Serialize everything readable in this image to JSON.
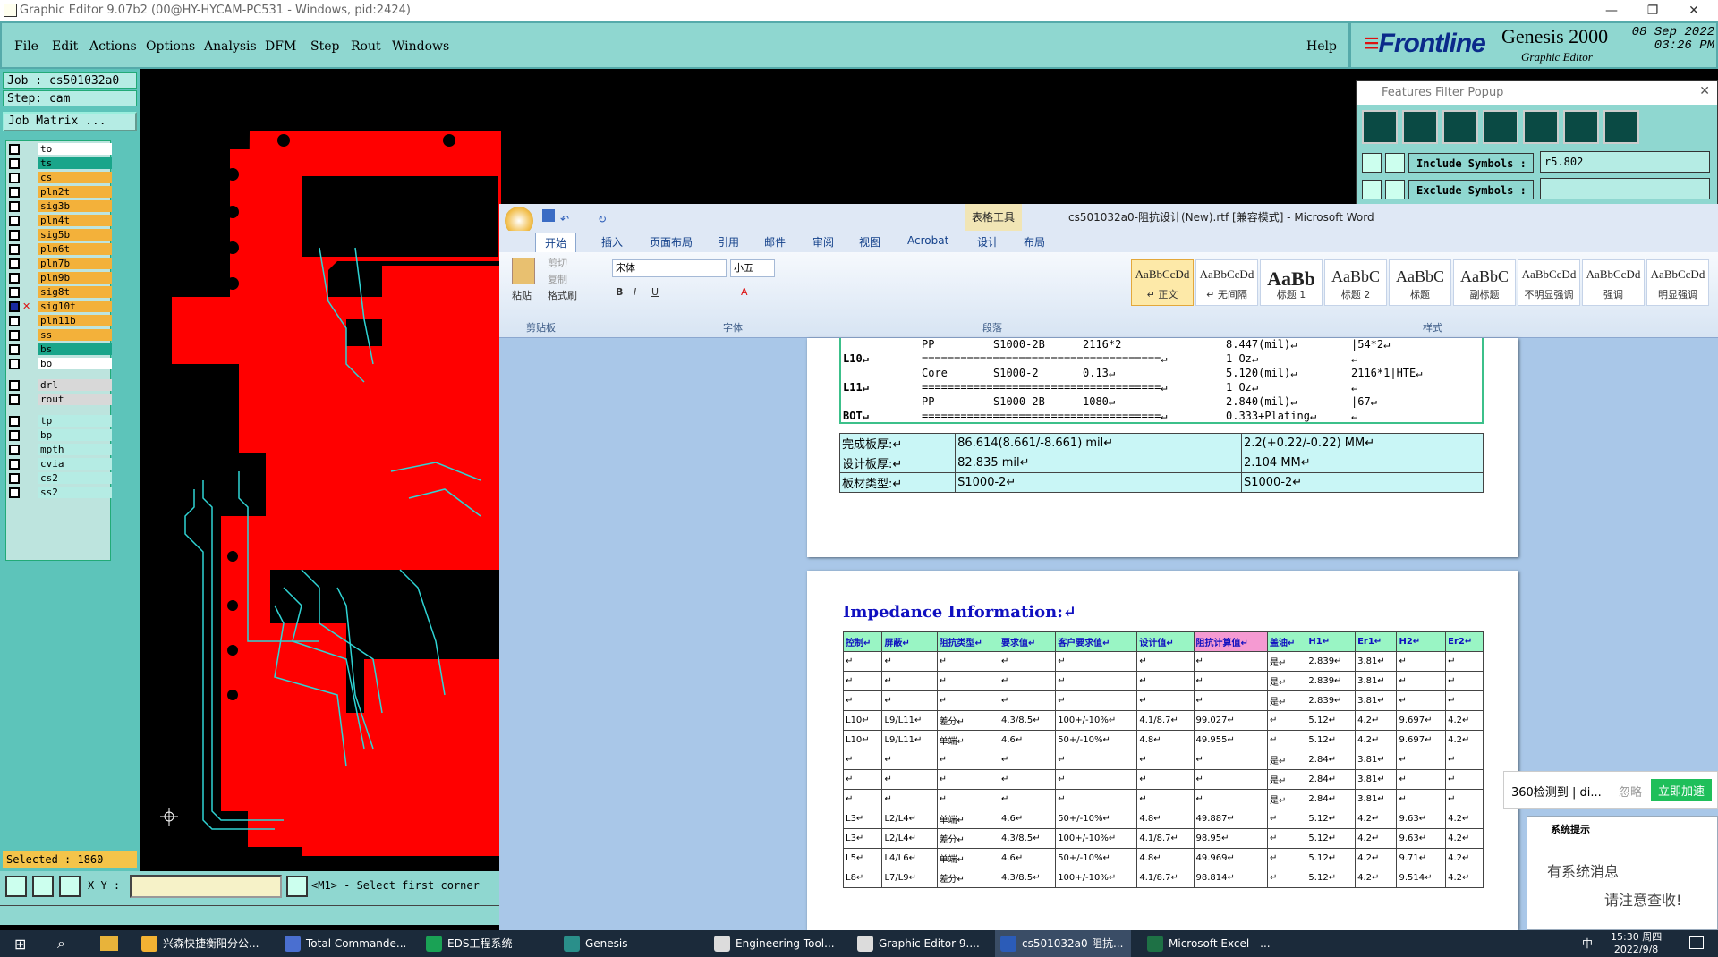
{
  "genesis": {
    "title": "Graphic Editor 9.07b2 (00@HY-HYCAM-PC531 - Windows, pid:2424)",
    "menus": [
      "File",
      "Edit",
      "Actions",
      "Options",
      "Analysis",
      "DFM",
      "Step",
      "Rout",
      "Windows"
    ],
    "help": "Help",
    "brand": {
      "logo": "Frontline",
      "product": "Genesis 2000",
      "subtitle": "Graphic Editor",
      "date": "08 Sep 2022",
      "time": "03:26 PM"
    },
    "job_label": "Job : cs501032a0",
    "step_label": "Step: cam",
    "job_matrix": "Job Matrix ...",
    "layers": [
      {
        "name": "to",
        "color": "#ffffff",
        "mark": "pen"
      },
      {
        "name": "ts",
        "color": "#19a58a"
      },
      {
        "name": "cs",
        "color": "#f3b13a"
      },
      {
        "name": "pln2t",
        "color": "#f3b13a"
      },
      {
        "name": "sig3b",
        "color": "#f3b13a"
      },
      {
        "name": "pln4t",
        "color": "#f3b13a"
      },
      {
        "name": "sig5b",
        "color": "#f3b13a"
      },
      {
        "name": "pln6t",
        "color": "#f3b13a"
      },
      {
        "name": "pln7b",
        "color": "#f3b13a"
      },
      {
        "name": "pln9b",
        "color": "#f3b13a"
      },
      {
        "name": "sig8t",
        "color": "#f3b13a"
      },
      {
        "name": "sig10t",
        "color": "#f3b13a",
        "active": true,
        "mark": "eq"
      },
      {
        "name": "pln11b",
        "color": "#f3b13a"
      },
      {
        "name": "ss",
        "color": "#f3b13a"
      },
      {
        "name": "bs",
        "color": "#19a58a"
      },
      {
        "name": "bo",
        "color": "#ffffff",
        "mark": "pen"
      },
      {
        "name": "drl",
        "color": "#d8d8d8"
      },
      {
        "name": "rout",
        "color": "#d8d8d8"
      },
      {
        "name": "tp",
        "color": "#b5ece4"
      },
      {
        "name": "bp",
        "color": "#b5ece4"
      },
      {
        "name": "mpth",
        "color": "#b5ece4"
      },
      {
        "name": "cvia",
        "color": "#b5ece4"
      },
      {
        "name": "cs2",
        "color": "#b5ece4"
      },
      {
        "name": "ss2",
        "color": "#b5ece4"
      }
    ],
    "selected": "Selected : 1860",
    "xy_label": "X Y :",
    "status": "<M1> - Select first corner"
  },
  "features_filter": {
    "title": "Features Filter Popup",
    "include_label": "Include Symbols :",
    "include_value": "r5.802",
    "exclude_label": "Exclude Symbols :",
    "exclude_value": ""
  },
  "word": {
    "tool_context": "表格工具",
    "title": "cs501032a0-阻抗设计(New).rtf [兼容模式] - Microsoft Word",
    "tabs": [
      "开始",
      "插入",
      "页面布局",
      "引用",
      "邮件",
      "审阅",
      "视图",
      "Acrobat",
      "设计",
      "布局"
    ],
    "clipboard": {
      "paste": "粘贴",
      "cut": "剪切",
      "copy": "复制",
      "format_painter": "格式刷",
      "group": "剪贴板"
    },
    "font": {
      "name": "宋体",
      "size": "小五",
      "group": "字体"
    },
    "paragraph_group": "段落",
    "styles_group": "样式",
    "styles": [
      {
        "preview": "AaBbCcDd",
        "name": "↵ 正文"
      },
      {
        "preview": "AaBbCcDd",
        "name": "↵ 无间隔"
      },
      {
        "preview": "AaBb",
        "name": "标题 1"
      },
      {
        "preview": "AaBbC",
        "name": "标题 2"
      },
      {
        "preview": "AaBbC",
        "name": "标题"
      },
      {
        "preview": "AaBbC",
        "name": "副标题"
      },
      {
        "preview": "AaBbCcDd",
        "name": "不明显强调"
      },
      {
        "preview": "AaBbCcDd",
        "name": "强调"
      },
      {
        "preview": "AaBbCcDd",
        "name": "明显强调"
      }
    ],
    "stackup": [
      {
        "layer": "",
        "c1": "PP",
        "c2": "S1000-2B",
        "c3": "2116*2",
        "val": "8.447(mil)↵",
        "note": "|54*2↵"
      },
      {
        "layer": "L10↵",
        "c1": "=====================================↵",
        "c2": "",
        "c3": "",
        "val": "1 Oz↵",
        "note": "↵"
      },
      {
        "layer": "",
        "c1": "Core",
        "c2": "S1000-2",
        "c3": "0.13↵",
        "val": "5.120(mil)↵",
        "note": "2116*1|HTE↵"
      },
      {
        "layer": "L11↵",
        "c1": "=====================================↵",
        "c2": "",
        "c3": "",
        "val": "1 Oz↵",
        "note": "↵"
      },
      {
        "layer": "",
        "c1": "PP",
        "c2": "S1000-2B",
        "c3": "1080↵",
        "val": "2.840(mil)↵",
        "note": "|67↵"
      },
      {
        "layer": "BOT↵",
        "c1": "=====================================↵",
        "c2": "",
        "c3": "",
        "val": "0.333+Plating↵",
        "note": "↵"
      }
    ],
    "summary": [
      {
        "label": "完成板厚:↵",
        "mil": "86.614(8.661/-8.661) mil↵",
        "mm": "2.2(+0.22/-0.22) MM↵"
      },
      {
        "label": "设计板厚:↵",
        "mil": "82.835 mil↵",
        "mm": "2.104 MM↵"
      },
      {
        "label": "板材类型:↵",
        "mil": "S1000-2↵",
        "mm": "S1000-2↵"
      }
    ],
    "impedance_title": "Impedance Information:↵",
    "imp_headers": [
      "控制↵",
      "屏蔽↵",
      "阻抗类型↵",
      "要求值↵",
      "客户要求值↵",
      "设计值↵",
      "阻抗计算值↵",
      "盖油↵",
      "H1↵",
      "Er1↵",
      "H2↵",
      "Er2↵"
    ],
    "imp_rows": [
      [
        "↵",
        "↵",
        "↵",
        "↵",
        "↵",
        "↵",
        "↵",
        "是↵",
        "2.839↵",
        "3.81↵",
        "↵",
        "↵"
      ],
      [
        "↵",
        "↵",
        "↵",
        "↵",
        "↵",
        "↵",
        "↵",
        "是↵",
        "2.839↵",
        "3.81↵",
        "↵",
        "↵"
      ],
      [
        "↵",
        "↵",
        "↵",
        "↵",
        "↵",
        "↵",
        "↵",
        "是↵",
        "2.839↵",
        "3.81↵",
        "↵",
        "↵"
      ],
      [
        "L10↵",
        "L9/L11↵",
        "差分↵",
        "4.3/8.5↵",
        "100+/-10%↵",
        "4.1/8.7↵",
        "99.027↵",
        "↵",
        "5.12↵",
        "4.2↵",
        "9.697↵",
        "4.2↵"
      ],
      [
        "L10↵",
        "L9/L11↵",
        "单端↵",
        "4.6↵",
        "50+/-10%↵",
        "4.8↵",
        "49.955↵",
        "↵",
        "5.12↵",
        "4.2↵",
        "9.697↵",
        "4.2↵"
      ],
      [
        "↵",
        "↵",
        "↵",
        "↵",
        "↵",
        "↵",
        "↵",
        "是↵",
        "2.84↵",
        "3.81↵",
        "↵",
        "↵"
      ],
      [
        "↵",
        "↵",
        "↵",
        "↵",
        "↵",
        "↵",
        "↵",
        "是↵",
        "2.84↵",
        "3.81↵",
        "↵",
        "↵"
      ],
      [
        "↵",
        "↵",
        "↵",
        "↵",
        "↵",
        "↵",
        "↵",
        "是↵",
        "2.84↵",
        "3.81↵",
        "↵",
        "↵"
      ],
      [
        "L3↵",
        "L2/L4↵",
        "单端↵",
        "4.6↵",
        "50+/-10%↵",
        "4.8↵",
        "49.887↵",
        "↵",
        "5.12↵",
        "4.2↵",
        "9.63↵",
        "4.2↵"
      ],
      [
        "L3↵",
        "L2/L4↵",
        "差分↵",
        "4.3/8.5↵",
        "100+/-10%↵",
        "4.1/8.7↵",
        "98.95↵",
        "↵",
        "5.12↵",
        "4.2↵",
        "9.63↵",
        "4.2↵"
      ],
      [
        "L5↵",
        "L4/L6↵",
        "单端↵",
        "4.6↵",
        "50+/-10%↵",
        "4.8↵",
        "49.969↵",
        "↵",
        "5.12↵",
        "4.2↵",
        "9.71↵",
        "4.2↵"
      ],
      [
        "L8↵",
        "L7/L9↵",
        "差分↵",
        "4.3/8.5↵",
        "100+/-10%↵",
        "4.1/8.7↵",
        "98.814↵",
        "↵",
        "5.12↵",
        "4.2↵",
        "9.514↵",
        "4.2↵"
      ]
    ]
  },
  "popup360": {
    "text": "360检测到 | di...",
    "ignore": "忽略",
    "action": "立即加速"
  },
  "sysmsg": {
    "header": "系统提示",
    "line1": "有系统消息",
    "line2": "请注意查收!"
  },
  "taskbar": {
    "items": [
      {
        "label": "兴森快捷衡阳分公...",
        "color": "#f2b233"
      },
      {
        "label": "Total Commande...",
        "color": "#4a6fd0"
      },
      {
        "label": "EDS工程系统",
        "color": "#1aa255"
      },
      {
        "label": "Genesis",
        "color": "#2a8f8a"
      },
      {
        "label": "Engineering Tool...",
        "color": "#dcdcdc"
      },
      {
        "label": "Graphic Editor 9....",
        "color": "#dcdcdc"
      },
      {
        "label": "cs501032a0-阻抗...",
        "color": "#2b5cb8"
      },
      {
        "label": "Microsoft Excel - ...",
        "color": "#1e7145"
      }
    ],
    "ime": "中",
    "time": "15:30 周四",
    "date": "2022/9/8"
  }
}
